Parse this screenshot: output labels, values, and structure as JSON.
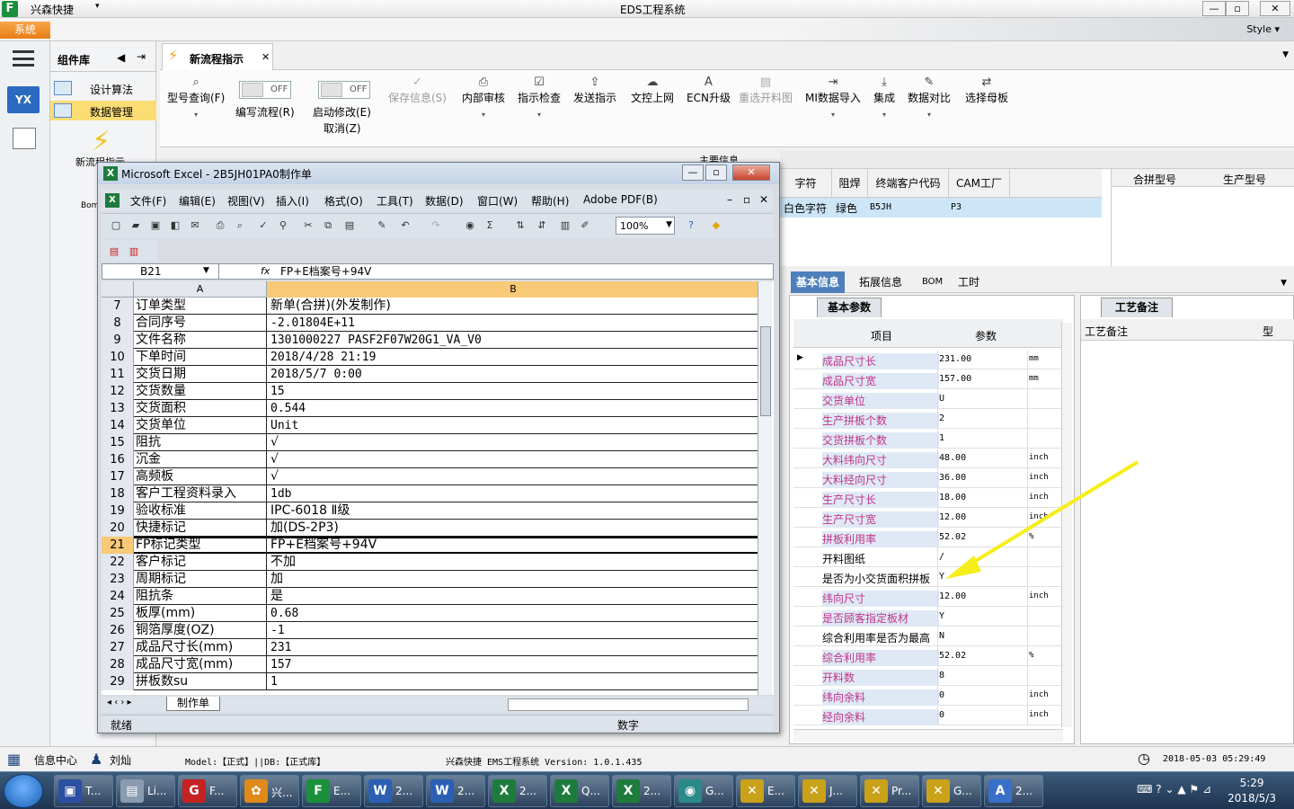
{
  "titlebar": {
    "app_name": "兴森快捷",
    "quick_access": "▾",
    "window_title": "EDS工程系统",
    "min": "—",
    "max": "▫",
    "close": "✕"
  },
  "menubar": {
    "system": "系统",
    "style": "Style",
    "style_caret": "▾"
  },
  "leftnav": {
    "tile_label": "YX"
  },
  "components": {
    "title": "组件库",
    "back": "◀",
    "pin": "⇥",
    "items": [
      {
        "label": "设计算法"
      },
      {
        "label": "数据管理"
      }
    ],
    "big_item": "新流程指示",
    "bom": "Bom"
  },
  "tab": {
    "label": "新流程指示",
    "close": "✕",
    "dropdown": "▼"
  },
  "ribbon": {
    "query": {
      "icon": "⌕",
      "label": "型号查询(F)",
      "caret": "▾"
    },
    "write_flow": {
      "label": "编写流程(R)",
      "state": "OFF"
    },
    "start_modify": {
      "label": "启动修改(E)",
      "label2": "取消(Z)",
      "state": "OFF"
    },
    "save": {
      "icon": "✓",
      "label": "保存信息(S)"
    },
    "internal_review": {
      "icon": "⎙",
      "label": "内部审核",
      "caret": "▾"
    },
    "check": {
      "icon": "☑",
      "label": "指示检查",
      "caret": "▾"
    },
    "send": {
      "icon": "⇪",
      "label": "发送指示"
    },
    "upload": {
      "icon": "☁",
      "label": "文控上网"
    },
    "ecn": {
      "icon": "A",
      "label": "ECN升级"
    },
    "reselect": {
      "icon": "▤",
      "label": "重选开料图"
    },
    "mi_import": {
      "icon": "⇥",
      "label": "MI数据导入",
      "caret": "▾"
    },
    "integrate": {
      "icon": "⤓",
      "label": "集成",
      "caret": "▾"
    },
    "compare": {
      "icon": "✎",
      "label": "数据对比",
      "caret": "▾"
    },
    "mother": {
      "icon": "⇄",
      "label": "选择母板"
    }
  },
  "grid_top": {
    "main_info": "主要信息",
    "headers": [
      "字符",
      "阻焊",
      "终端客户代码",
      "CAM工厂"
    ],
    "row": [
      "白色字符",
      "绿色",
      "B5JH",
      "P3"
    ],
    "right_headers": [
      "合拼型号",
      "生产型号"
    ]
  },
  "info_tabs": [
    {
      "label": "基本信息"
    },
    {
      "label": "拓展信息"
    },
    {
      "label": "BOM"
    },
    {
      "label": "工时"
    }
  ],
  "info_tabs_dropdown": "▼",
  "params": {
    "tab": "基本参数",
    "header_item": "项目",
    "header_value": "参数",
    "rows": [
      {
        "name": "成品尺寸长",
        "value": "231.00",
        "unit": "mm"
      },
      {
        "name": "成品尺寸宽",
        "value": "157.00",
        "unit": "mm"
      },
      {
        "name": "交货单位",
        "value": "U",
        "unit": ""
      },
      {
        "name": "生产拼板个数",
        "value": "2",
        "unit": ""
      },
      {
        "name": "交货拼板个数",
        "value": "1",
        "unit": ""
      },
      {
        "name": "大料纬向尺寸",
        "value": "48.00",
        "unit": "inch"
      },
      {
        "name": "大料经向尺寸",
        "value": "36.00",
        "unit": "inch"
      },
      {
        "name": "生产尺寸长",
        "value": "18.00",
        "unit": "inch"
      },
      {
        "name": "生产尺寸宽",
        "value": "12.00",
        "unit": "inch"
      },
      {
        "name": "拼板利用率",
        "value": "52.02",
        "unit": "%"
      },
      {
        "name": "开料图纸",
        "value": "/",
        "unit": ""
      },
      {
        "name": "是否为小交货面积拼板",
        "value": "Y",
        "unit": ""
      },
      {
        "name": "纬向尺寸",
        "value": "12.00",
        "unit": "inch"
      },
      {
        "name": "是否顾客指定板材",
        "value": "Y",
        "unit": ""
      },
      {
        "name": "综合利用率是否为最高",
        "value": "N",
        "unit": ""
      },
      {
        "name": "综合利用率",
        "value": "52.02",
        "unit": "%"
      },
      {
        "name": "开料数",
        "value": "8",
        "unit": ""
      },
      {
        "name": "纬向余料",
        "value": "0",
        "unit": "inch"
      },
      {
        "name": "经向余料",
        "value": "0",
        "unit": "inch"
      }
    ]
  },
  "notes": {
    "tab": "工艺备注",
    "header": "工艺备注",
    "header2": "型"
  },
  "excel": {
    "title": "Microsoft Excel - 2B5JH01PA0制作单",
    "menu": [
      "文件(F)",
      "编辑(E)",
      "视图(V)",
      "插入(I)",
      "格式(O)",
      "工具(T)",
      "数据(D)",
      "窗口(W)",
      "帮助(H)",
      "Adobe PDF(B)"
    ],
    "zoom": "100%",
    "name_box": "B21",
    "fx": "fx",
    "formula": "FP+E档案号+94V",
    "col_a": "A",
    "col_b": "B",
    "rows": [
      {
        "n": "7",
        "a": "订单类型",
        "b": "新单(合拼)(外发制作)"
      },
      {
        "n": "8",
        "a": "合同序号",
        "b": "-2.01804E+11"
      },
      {
        "n": "9",
        "a": "文件名称",
        "b": "1301000227 PASF2F07W20G1_VA_V0"
      },
      {
        "n": "10",
        "a": "下单时间",
        "b": "2018/4/28 21:19"
      },
      {
        "n": "11",
        "a": "交货日期",
        "b": "2018/5/7 0:00"
      },
      {
        "n": "12",
        "a": "交货数量",
        "b": "15"
      },
      {
        "n": "13",
        "a": "交货面积",
        "b": "0.544"
      },
      {
        "n": "14",
        "a": "交货单位",
        "b": "Unit"
      },
      {
        "n": "15",
        "a": "阻抗",
        "b": "√"
      },
      {
        "n": "16",
        "a": "沉金",
        "b": "√"
      },
      {
        "n": "17",
        "a": "高频板",
        "b": "√"
      },
      {
        "n": "18",
        "a": "客户工程资料录入",
        "b": "1db"
      },
      {
        "n": "19",
        "a": "验收标准",
        "b": "IPC-6018 Ⅱ级"
      },
      {
        "n": "20",
        "a": "快捷标记",
        "b": "加(DS-2P3)"
      },
      {
        "n": "21",
        "a": "FP标记类型",
        "b": "FP+E档案号+94V"
      },
      {
        "n": "22",
        "a": "客户标记",
        "b": "不加"
      },
      {
        "n": "23",
        "a": "周期标记",
        "b": "加"
      },
      {
        "n": "24",
        "a": "阻抗条",
        "b": "是"
      },
      {
        "n": "25",
        "a": "板厚(mm)",
        "b": "0.68"
      },
      {
        "n": "26",
        "a": "铜箔厚度(OZ)",
        "b": "-1"
      },
      {
        "n": "27",
        "a": "成品尺寸长(mm)",
        "b": "231"
      },
      {
        "n": "28",
        "a": "成品尺寸宽(mm)",
        "b": "157"
      },
      {
        "n": "29",
        "a": "拼板数su",
        "b": "1"
      }
    ],
    "sheet_tab": "制作单",
    "status_ready": "就绪",
    "status_num": "数字"
  },
  "statusbar": {
    "info_center": "信息中心",
    "user": "刘灿",
    "model": "Model:【正式】||DB:【正式库】",
    "version": "兴森快捷 EMS工程系统 Version: 1.0.1.435",
    "datetime": "2018-05-03 05:29:49"
  },
  "taskbar": {
    "items": [
      {
        "icon": "▣",
        "label": "T...",
        "color": "#2b4fa3"
      },
      {
        "icon": "▤",
        "label": "Li...",
        "color": "#8a9bb0"
      },
      {
        "icon": "G",
        "label": "F...",
        "color": "#c72222"
      },
      {
        "icon": "✿",
        "label": "兴...",
        "color": "#e08a1a"
      },
      {
        "icon": "F",
        "label": "E...",
        "color": "#1a8f3c"
      },
      {
        "icon": "W",
        "label": "2...",
        "color": "#2b5fb4"
      },
      {
        "icon": "W",
        "label": "2...",
        "color": "#2b5fb4"
      },
      {
        "icon": "X",
        "label": "2...",
        "color": "#1e7b3c"
      },
      {
        "icon": "X",
        "label": "Q...",
        "color": "#1e7b3c"
      },
      {
        "icon": "X",
        "label": "2...",
        "color": "#1e7b3c"
      },
      {
        "icon": "◉",
        "label": "G...",
        "color": "#2a8a8a"
      },
      {
        "icon": "✕",
        "label": "E...",
        "color": "#c9a21a"
      },
      {
        "icon": "✕",
        "label": "J...",
        "color": "#c9a21a"
      },
      {
        "icon": "✕",
        "label": "Pr...",
        "color": "#c9a21a"
      },
      {
        "icon": "✕",
        "label": "G...",
        "color": "#c9a21a"
      },
      {
        "icon": "A",
        "label": "2...",
        "color": "#3a6fc9"
      }
    ],
    "time": "5:29",
    "date": "2018/5/3",
    "tray": "⌨ ? ⌄ ▲ ⚑ ⊿"
  }
}
